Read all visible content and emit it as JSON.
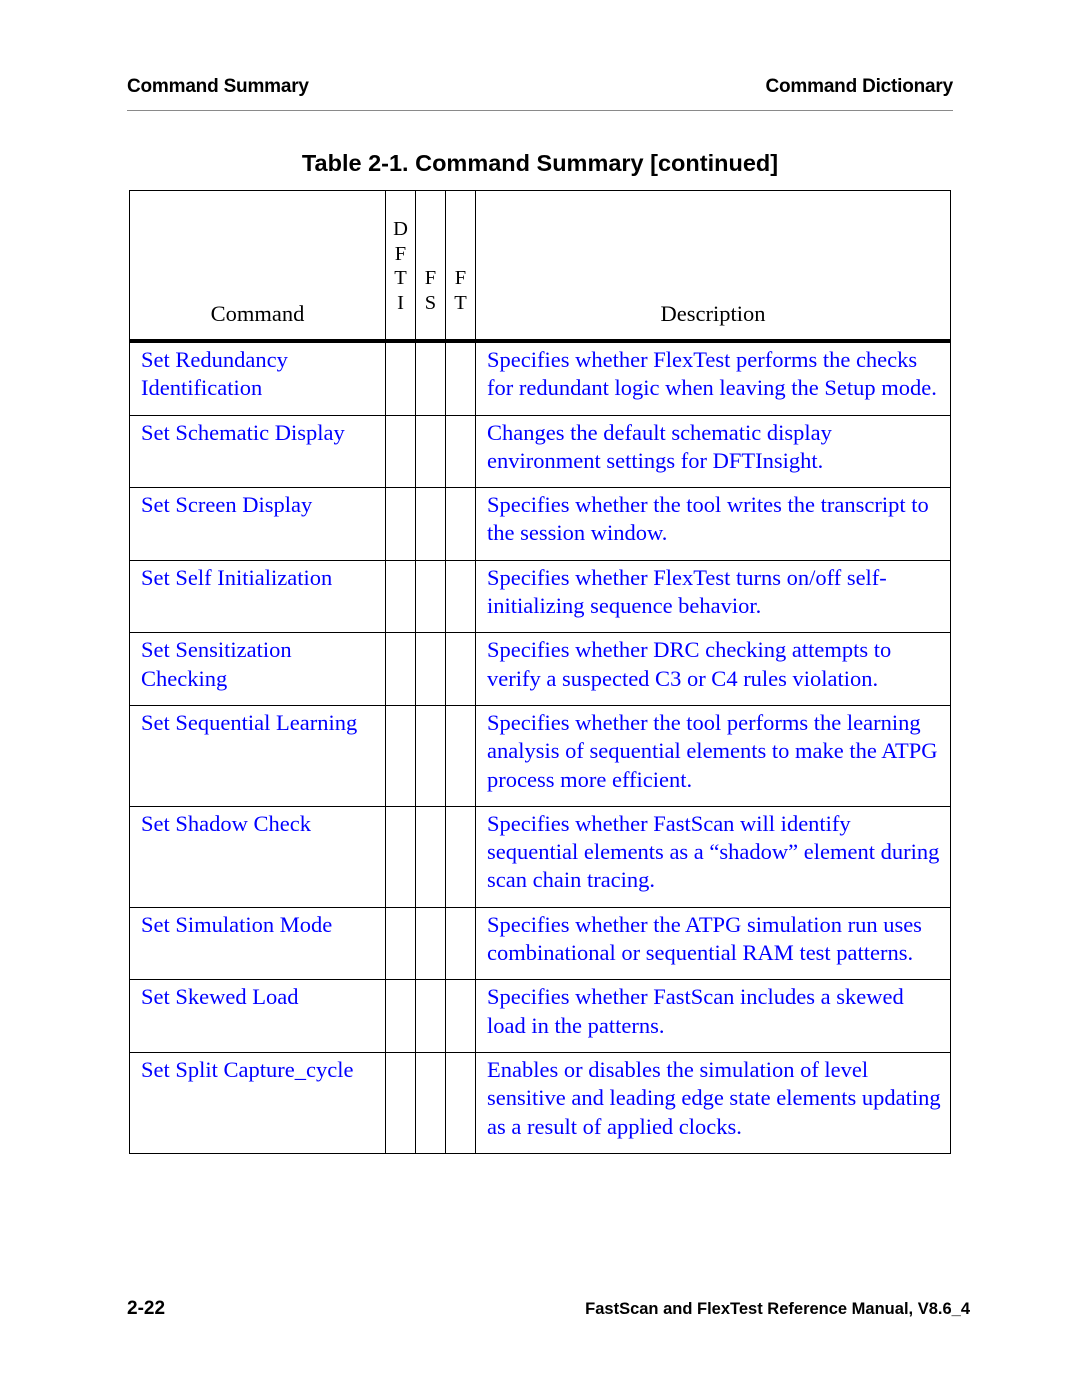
{
  "running_header": {
    "left": "Command Summary",
    "right": "Command Dictionary"
  },
  "table_title": "Table 2-1. Command Summary [continued]",
  "table": {
    "headers": {
      "command": "Command",
      "dfti": [
        "D",
        "F",
        "T",
        "I"
      ],
      "fs": [
        "F",
        "S"
      ],
      "ft": [
        "F",
        "T"
      ],
      "description": "Description"
    },
    "rows": [
      {
        "command": "Set Redundancy Identification",
        "dfti": "",
        "fs": "",
        "ft": "",
        "description": "Specifies whether FlexTest performs the checks for redundant logic when leaving the Setup mode."
      },
      {
        "command": "Set Schematic Display",
        "dfti": "",
        "fs": "",
        "ft": "",
        "description": "Changes the default schematic display environment settings for DFTInsight."
      },
      {
        "command": "Set Screen Display",
        "dfti": "",
        "fs": "",
        "ft": "",
        "description": "Specifies whether the tool writes the transcript to the session window."
      },
      {
        "command": "Set Self Initialization",
        "dfti": "",
        "fs": "",
        "ft": "",
        "description": "Specifies whether FlexTest turns on/off self-initializing sequence behavior."
      },
      {
        "command": "Set Sensitization Checking",
        "dfti": "",
        "fs": "",
        "ft": "",
        "description": "Specifies whether DRC checking attempts to verify a suspected C3 or C4 rules violation."
      },
      {
        "command": "Set Sequential Learning",
        "dfti": "",
        "fs": "",
        "ft": "",
        "description": "Specifies whether the tool performs the learning analysis of sequential elements to make the ATPG process more efficient."
      },
      {
        "command": "Set Shadow Check",
        "dfti": "",
        "fs": "",
        "ft": "",
        "description": "Specifies whether FastScan will identify sequential elements as a “shadow” element during scan chain tracing."
      },
      {
        "command": "Set Simulation Mode",
        "dfti": "",
        "fs": "",
        "ft": "",
        "description": "Specifies whether the ATPG simulation run uses combinational or sequential RAM test patterns."
      },
      {
        "command": "Set Skewed Load",
        "dfti": "",
        "fs": "",
        "ft": "",
        "description": "Specifies whether FastScan includes a skewed load in the patterns."
      },
      {
        "command": "Set Split Capture_cycle",
        "dfti": "",
        "fs": "",
        "ft": "",
        "description": "Enables or disables the simulation of level sensitive and leading edge state elements updating as a result of applied clocks."
      }
    ]
  },
  "footer": {
    "page_number": "2-22",
    "manual_title": "FastScan and FlexTest Reference Manual, V8.6_4"
  },
  "colors": {
    "link": "#0000ff",
    "text": "#000000",
    "header_rule": "#8a8a8a"
  }
}
